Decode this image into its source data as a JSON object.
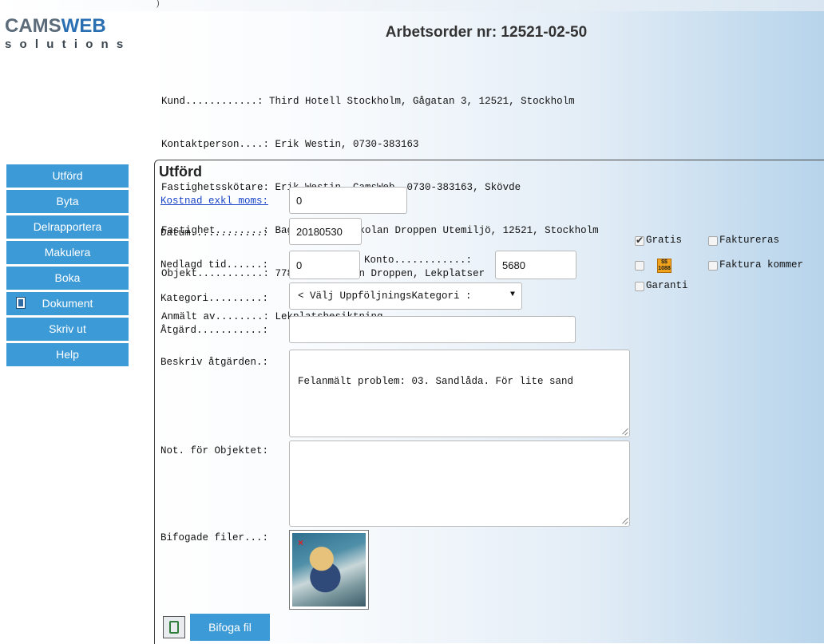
{
  "header": {
    "top_mark": ")",
    "logo_main_1": "CAMS",
    "logo_main_2": "WEB",
    "logo_sub": "solutions",
    "title": "Arbetsorder nr: 12521-02-50"
  },
  "info_lines": [
    "Kund............: Third Hotell Stockholm, Gågatan 3, 12521, Stockholm",
    "Kontaktperson....: Erik Westin, 0730-383163",
    "Fastighetsskötare: Erik Westin, CamsWeb, 0730-383163, Skövde",
    "Fastighet........: Baggen 2, Förskolan Droppen Utemiljö, 12521, Stockholm",
    "Objekt...........: 7788, Förskolan Droppen, Lekplatser",
    "Anmält av........: Lekplatsbesiktning"
  ],
  "sidebar": {
    "items": [
      {
        "label": "Utförd"
      },
      {
        "label": "Byta"
      },
      {
        "label": "Delrapportera"
      },
      {
        "label": "Makulera"
      },
      {
        "label": "Boka"
      },
      {
        "label": "Dokument"
      },
      {
        "label": "Skriv ut"
      },
      {
        "label": "Help"
      }
    ]
  },
  "form": {
    "title": "Utförd",
    "kostnad_label": "Kostnad exkl moms:",
    "kostnad_value": "0",
    "datum_label": "Datum............:",
    "datum_value": "20180530",
    "nedlagd_label": "Nedlagd tid......:",
    "nedlagd_value": "0",
    "konto_label": "Konto............:",
    "konto_value": "5680",
    "kategori_label": "Kategori.........:",
    "kategori_value": "< Välj UppföljningsKategori :",
    "atgard_label": "Åtgärd...........:",
    "atgard_value": "",
    "beskriv_label": "Beskriv åtgärden.:",
    "beskriv_value": "Felanmält problem: 03. Sandlåda. För lite sand",
    "not_label": "Not. för Objektet:",
    "not_value": "",
    "bifogade_label": "Bifogade filer...:",
    "bifoga_button": "Bifoga fil"
  },
  "options": {
    "gratis": {
      "label": "Gratis",
      "checked": true
    },
    "faktureras": {
      "label": "Faktureras",
      "checked": false
    },
    "price_icon": {
      "checked": false,
      "text_top": "$$",
      "text_bottom": "1088"
    },
    "faktura_kommer": {
      "label": "Faktura kommer",
      "checked": false
    },
    "garanti": {
      "label": "Garanti",
      "checked": false
    }
  },
  "colors": {
    "nav_button": "#3c9ad6",
    "link": "#1a44c8",
    "logo_blue": "#2a6fb2"
  }
}
